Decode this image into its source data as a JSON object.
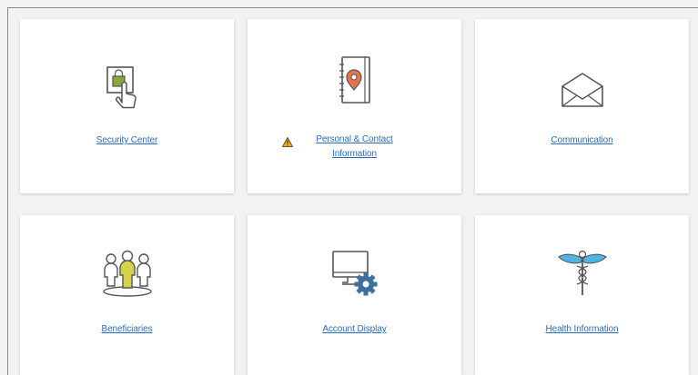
{
  "colors": {
    "link": "#2a6ebb",
    "icon_stroke": "#555555",
    "lock_green": "#8aa83c",
    "pin_orange": "#e8734a",
    "person_yellow": "#d6d24a",
    "gear_blue": "#3e6f9e",
    "wing_blue": "#4db4e3",
    "warning_yellow": "#f0b400"
  },
  "tiles": [
    {
      "label": "Security Center",
      "icon": "lock-touch-icon"
    },
    {
      "label": "Personal & Contact Information",
      "icon": "address-book-pin-icon",
      "warning": "warning-icon"
    },
    {
      "label": "Communication",
      "icon": "envelope-open-icon"
    },
    {
      "label": "Beneficiaries",
      "icon": "people-group-icon"
    },
    {
      "label": "Account Display",
      "icon": "monitor-gear-icon"
    },
    {
      "label": "Health Information",
      "icon": "caduceus-icon"
    }
  ]
}
